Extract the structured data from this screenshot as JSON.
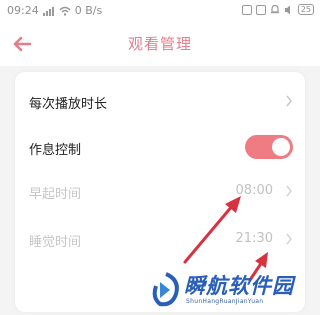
{
  "status_bar": {
    "time": "09:24",
    "speed": "0 B/s",
    "battery": "25"
  },
  "header": {
    "title": "观看管理"
  },
  "settings": {
    "rows": [
      {
        "label": "每次播放时长",
        "value": ""
      },
      {
        "label": "作息控制",
        "toggle": true
      },
      {
        "label": "早起时间",
        "value": "08:00"
      },
      {
        "label": "睡觉时间",
        "value": "21:30"
      }
    ]
  },
  "colors": {
    "accent": "#ef7b83",
    "title": "#e57d8b",
    "arrow": "#d9323f"
  },
  "watermark": {
    "text": "瞬航软件园",
    "sub": "ShunHangRuanJianYuan"
  }
}
